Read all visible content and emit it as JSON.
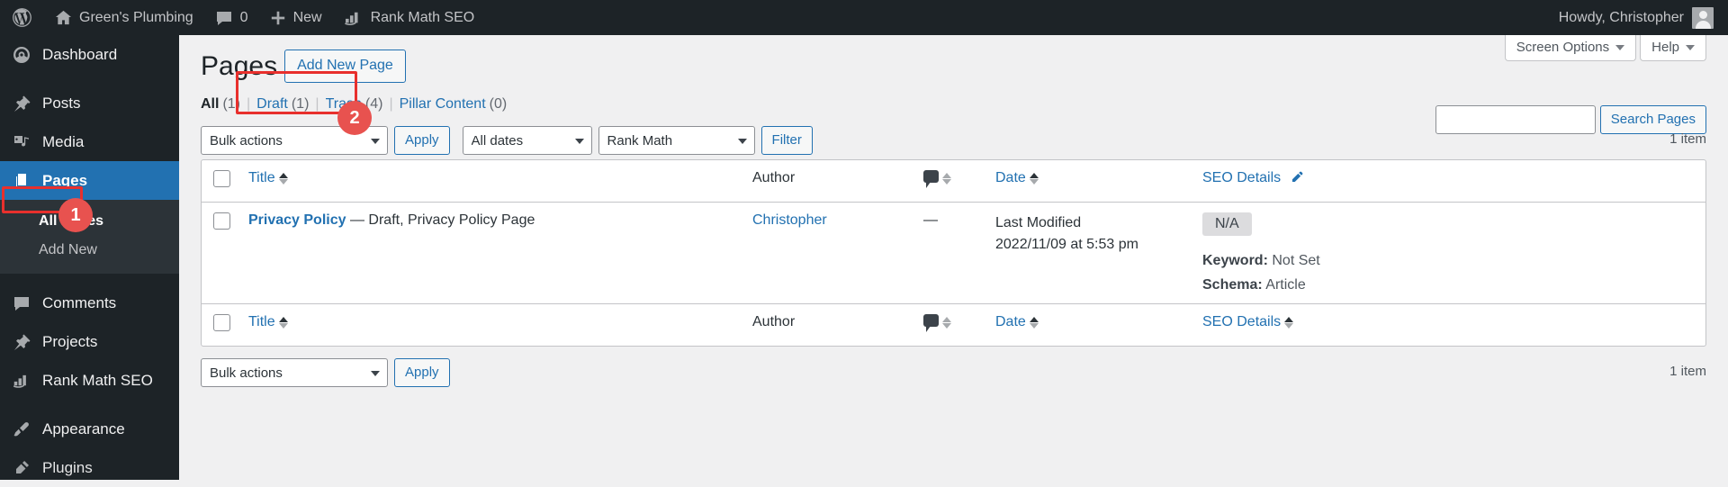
{
  "adminbar": {
    "logo_icon": "wordpress-logo-icon",
    "site_name": "Green's Plumbing",
    "site_icon": "home-icon",
    "comments_icon": "comment-bubble-icon",
    "comments_count": "0",
    "new_icon": "plus-icon",
    "new_label": "New",
    "rank_math_icon": "rank-math-icon",
    "rank_math_label": "Rank Math SEO",
    "howdy": "Howdy, Christopher",
    "avatar_icon": "user-avatar-icon"
  },
  "sidebar": {
    "items": [
      {
        "label": "Dashboard",
        "icon": "dashboard-icon"
      },
      {
        "label": "Posts",
        "icon": "pin-icon"
      },
      {
        "label": "Media",
        "icon": "media-icon"
      },
      {
        "label": "Pages",
        "icon": "pages-icon"
      },
      {
        "label": "Comments",
        "icon": "comment-icon"
      },
      {
        "label": "Projects",
        "icon": "pin-icon"
      },
      {
        "label": "Rank Math SEO",
        "icon": "rank-math-icon"
      },
      {
        "label": "Appearance",
        "icon": "paintbrush-icon"
      },
      {
        "label": "Plugins",
        "icon": "plugins-icon"
      }
    ],
    "submenu": [
      {
        "label": "All Pages"
      },
      {
        "label": "Add New"
      }
    ]
  },
  "screen_meta": {
    "screen_options": "Screen Options",
    "help": "Help"
  },
  "page": {
    "title": "Pages",
    "add_new_label": "Add New Page"
  },
  "annotations": {
    "step_one": "1",
    "step_two": "2"
  },
  "subsubsub": [
    {
      "label": "All",
      "count": "(1)"
    },
    {
      "label": "Draft",
      "count": "(1)"
    },
    {
      "label": "Trash",
      "count": "(4)"
    },
    {
      "label": "Pillar Content",
      "count": "(0)"
    }
  ],
  "search": {
    "value": "",
    "placeholder": "",
    "button_label": "Search Pages",
    "icon": "search-icon"
  },
  "tablenav_top": {
    "bulk_actions": "Bulk actions",
    "apply_label": "Apply",
    "all_dates": "All dates",
    "rank_math": "Rank Math",
    "filter_label": "Filter",
    "displaying_num": "1 item"
  },
  "tablenav_bottom": {
    "bulk_actions": "Bulk actions",
    "apply_label": "Apply",
    "displaying_num": "1 item"
  },
  "table": {
    "columns": {
      "title": "Title",
      "author": "Author",
      "comments": "comment-bubble-icon",
      "date": "Date",
      "seo_details": "SEO Details"
    },
    "edit_icon": "pencil-icon",
    "rows": [
      {
        "title": "Privacy Policy",
        "state": " — Draft, Privacy Policy Page",
        "author": "Christopher",
        "comments": "—",
        "date_label": "Last Modified",
        "date_value": "2022/11/09 at 5:53 pm",
        "seo_score": "N/A",
        "keyword_label": "Keyword:",
        "keyword_value": "Not Set",
        "schema_label": "Schema:",
        "schema_value": "Article"
      }
    ]
  },
  "colors": {
    "accent": "#2271b1",
    "admin_bg": "#1d2327",
    "highlight": "#e8302d",
    "badge": "#e8524f"
  }
}
